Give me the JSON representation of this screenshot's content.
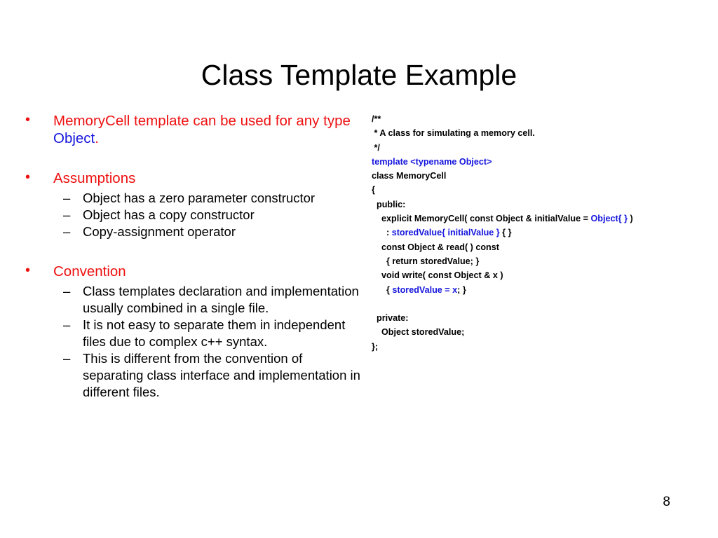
{
  "slide": {
    "title": "Class Template Example",
    "page_number": "8",
    "colors": {
      "accent_red": "#EE1111",
      "accent_blue": "#1515DD",
      "text_black": "#000000",
      "background": "#FFFFFF"
    }
  },
  "left_column": {
    "bullet_marker": "•",
    "dash_marker": "–",
    "blocks": [
      {
        "level1": {
          "parts": [
            {
              "text": "MemoryCell template can be used for any type ",
              "color": "red"
            },
            {
              "text": "Object",
              "color": "blue"
            },
            {
              "text": ".",
              "color": "red"
            }
          ]
        },
        "sub_items": []
      },
      {
        "level1": {
          "parts": [
            {
              "text": "Assumptions",
              "color": "red"
            }
          ]
        },
        "sub_items": [
          "Object has a zero parameter constructor",
          "Object has a copy constructor",
          "Copy-assignment operator"
        ]
      },
      {
        "level1": {
          "parts": [
            {
              "text": "Convention",
              "color": "red"
            }
          ]
        },
        "sub_items": [
          "Class templates declaration and implementation usually combined in a single file.",
          "It is not easy to separate them in independent files due to complex c++ syntax.",
          "This is different from the convention of separating class interface and implementation in different files."
        ]
      }
    ]
  },
  "code_block": {
    "language": "cpp",
    "lines": [
      [
        {
          "t": "/**",
          "c": "black"
        }
      ],
      [
        {
          "t": " * A class for simulating a memory cell.",
          "c": "black"
        }
      ],
      [
        {
          "t": " */",
          "c": "black"
        }
      ],
      [
        {
          "t": "template <typename Object>",
          "c": "blue"
        }
      ],
      [
        {
          "t": "class MemoryCell",
          "c": "black"
        }
      ],
      [
        {
          "t": "{",
          "c": "black"
        }
      ],
      [
        {
          "t": "  public:",
          "c": "black"
        }
      ],
      [
        {
          "t": "    explicit MemoryCell( const Object & initialValue = ",
          "c": "black"
        },
        {
          "t": "Object{ }",
          "c": "blue"
        },
        {
          "t": " )",
          "c": "black"
        }
      ],
      [
        {
          "t": "      : ",
          "c": "black"
        },
        {
          "t": "storedValue{ initialValue }",
          "c": "blue"
        },
        {
          "t": " { }",
          "c": "black"
        }
      ],
      [
        {
          "t": "    const Object & read( ) const",
          "c": "black"
        }
      ],
      [
        {
          "t": "      { return storedValue; }",
          "c": "black"
        }
      ],
      [
        {
          "t": "    void write( const Object & x )",
          "c": "black"
        }
      ],
      [
        {
          "t": "      { ",
          "c": "black"
        },
        {
          "t": "storedValue = x",
          "c": "blue"
        },
        {
          "t": "; }",
          "c": "black"
        }
      ],
      [
        {
          "t": "",
          "c": "black"
        }
      ],
      [
        {
          "t": "  private:",
          "c": "black"
        }
      ],
      [
        {
          "t": "    Object storedValue;",
          "c": "black"
        }
      ],
      [
        {
          "t": "};",
          "c": "black"
        }
      ]
    ]
  }
}
